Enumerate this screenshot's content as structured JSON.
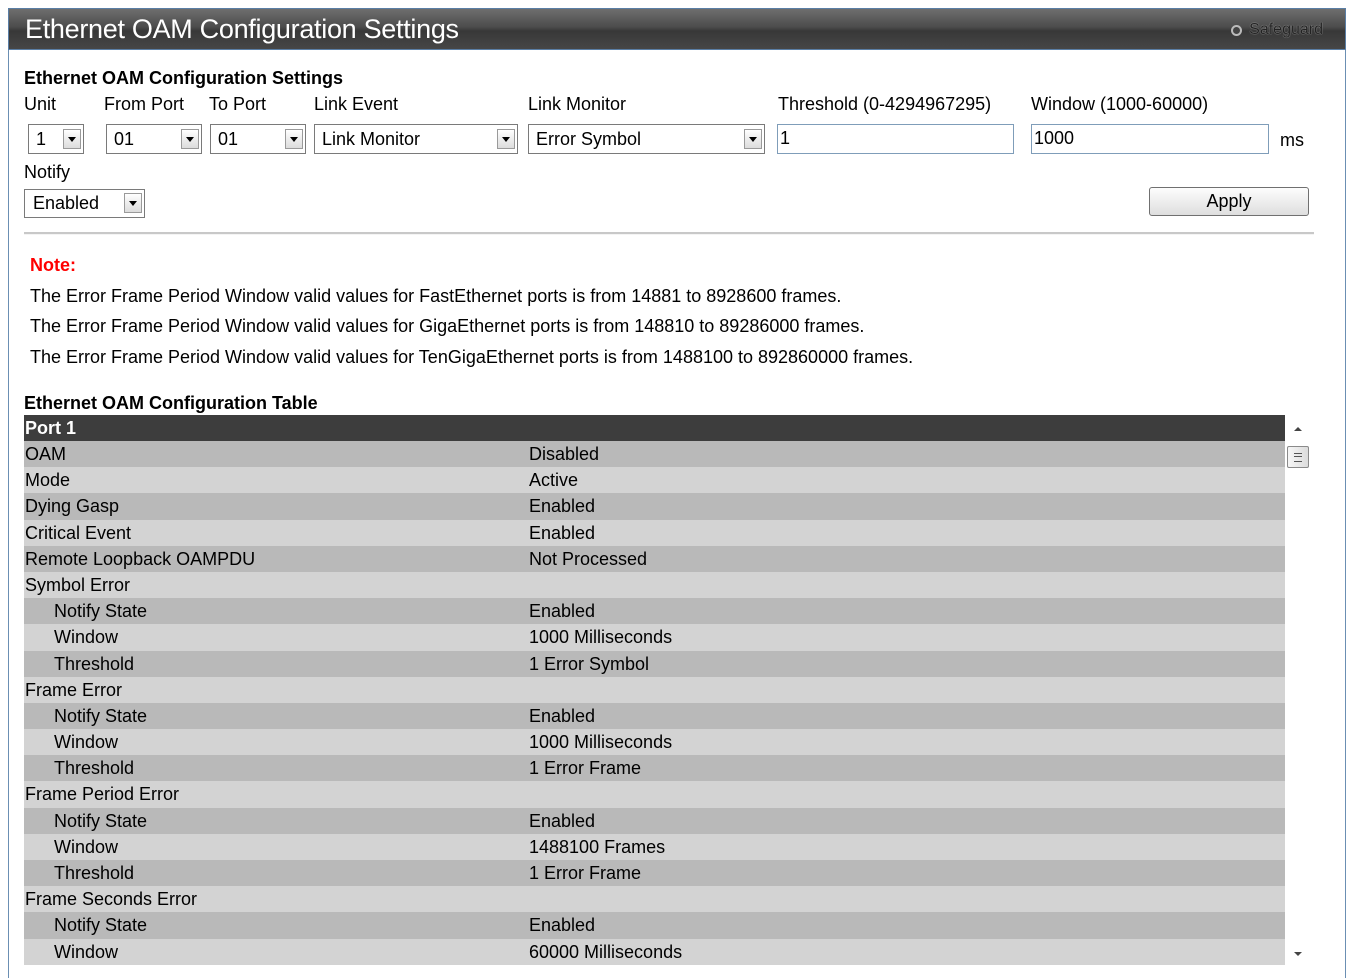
{
  "window": {
    "title": "Ethernet OAM Configuration Settings",
    "safeguard_label": "Safeguard"
  },
  "settings": {
    "section_title": "Ethernet OAM Configuration Settings",
    "unit_label": "Unit",
    "from_port_label": "From Port",
    "to_port_label": "To Port",
    "link_event_label": "Link Event",
    "link_monitor_label": "Link Monitor",
    "threshold_label": "Threshold (0-4294967295)",
    "window_label": "Window (1000-60000)",
    "unit_value": "1",
    "from_port_value": "01",
    "to_port_value": "01",
    "link_event_value": "Link Monitor",
    "link_monitor_value": "Error Symbol",
    "threshold_value": "1",
    "window_value": "1000",
    "window_unit": "ms",
    "notify_label": "Notify",
    "notify_value": "Enabled",
    "apply_label": "Apply"
  },
  "notes": {
    "heading": "Note:",
    "lines": [
      "The Error Frame Period Window valid values for FastEthernet ports is from 14881 to 8928600 frames.",
      "The Error Frame Period Window valid values for GigaEthernet ports is from 148810 to 89286000 frames.",
      "The Error Frame Period Window valid values for TenGigaEthernet ports is from 1488100 to 892860000 frames."
    ]
  },
  "table": {
    "title": "Ethernet OAM Configuration Table",
    "header": "Port 1",
    "rows": [
      {
        "key": "OAM",
        "value": "Disabled",
        "sub": false
      },
      {
        "key": "Mode",
        "value": "Active",
        "sub": false
      },
      {
        "key": "Dying Gasp",
        "value": "Enabled",
        "sub": false
      },
      {
        "key": "Critical Event",
        "value": "Enabled",
        "sub": false
      },
      {
        "key": "Remote Loopback OAMPDU",
        "value": "Not Processed",
        "sub": false
      },
      {
        "key": "Symbol Error",
        "value": "",
        "sub": false
      },
      {
        "key": "Notify State",
        "value": "Enabled",
        "sub": true
      },
      {
        "key": "Window",
        "value": "1000 Milliseconds",
        "sub": true
      },
      {
        "key": "Threshold",
        "value": "1 Error Symbol",
        "sub": true
      },
      {
        "key": "Frame Error",
        "value": "",
        "sub": false
      },
      {
        "key": "Notify State",
        "value": "Enabled",
        "sub": true
      },
      {
        "key": "Window",
        "value": "1000 Milliseconds",
        "sub": true
      },
      {
        "key": "Threshold",
        "value": "1 Error Frame",
        "sub": true
      },
      {
        "key": "Frame Period Error",
        "value": "",
        "sub": false
      },
      {
        "key": "Notify State",
        "value": "Enabled",
        "sub": true
      },
      {
        "key": "Window",
        "value": "1488100 Frames",
        "sub": true
      },
      {
        "key": "Threshold",
        "value": "1 Error Frame",
        "sub": true
      },
      {
        "key": "Frame Seconds Error",
        "value": "",
        "sub": false
      },
      {
        "key": "Notify State",
        "value": "Enabled",
        "sub": true
      },
      {
        "key": "Window",
        "value": "60000 Milliseconds",
        "sub": true
      }
    ]
  },
  "icons": {
    "safeguard": "radio-dot-icon",
    "dropdown": "chevron-down-icon",
    "scroll_up": "arrow-up-icon",
    "scroll_down": "arrow-down-icon"
  }
}
